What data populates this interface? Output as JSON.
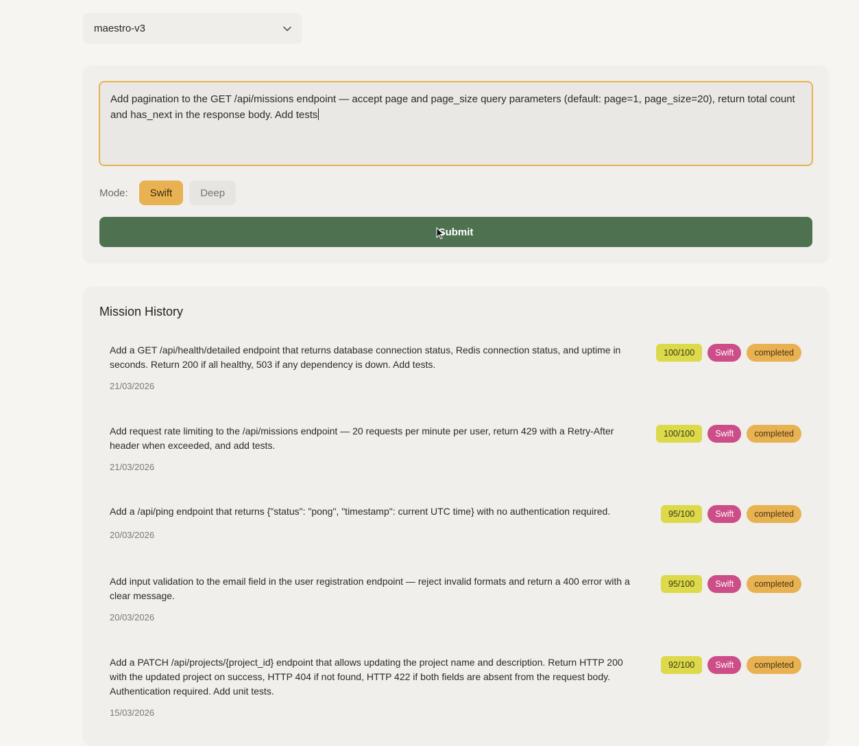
{
  "model_select": {
    "value": "maestro-v3",
    "icon": "chevron-down-icon"
  },
  "composer": {
    "prompt_text": "Add pagination to the GET /api/missions endpoint — accept page and page_size query parameters (default: page=1, page_size=20), return total count and has_next in the response body. Add tests",
    "mode_label": "Mode:",
    "modes": [
      "Swift",
      "Deep"
    ],
    "active_mode": "Swift",
    "submit_label": "Submit"
  },
  "history": {
    "title": "Mission History",
    "missions": [
      {
        "text": "Add a GET /api/health/detailed endpoint that returns database connection status, Redis connection status, and uptime in seconds. Return 200 if all healthy, 503 if any dependency is down. Add tests.",
        "date": "21/03/2026",
        "score": "100/100",
        "mode": "Swift",
        "status": "completed"
      },
      {
        "text": "Add request rate limiting to the /api/missions endpoint — 20 requests per minute per user, return 429 with a Retry-After header when exceeded, and add tests.",
        "date": "21/03/2026",
        "score": "100/100",
        "mode": "Swift",
        "status": "completed"
      },
      {
        "text": "Add a /api/ping endpoint that returns {\"status\": \"pong\", \"timestamp\": current UTC time} with no authentication required.",
        "date": "20/03/2026",
        "score": "95/100",
        "mode": "Swift",
        "status": "completed"
      },
      {
        "text": "Add input validation to the email field in the user registration endpoint — reject invalid formats and return a 400 error with a clear message.",
        "date": "20/03/2026",
        "score": "95/100",
        "mode": "Swift",
        "status": "completed"
      },
      {
        "text": "Add a PATCH /api/projects/{project_id} endpoint that allows updating the project name and description. Return HTTP 200 with the updated project on success, HTTP 404 if not found, HTTP 422 if both fields are absent from the request body. Authentication required. Add unit tests.",
        "date": "15/03/2026",
        "score": "92/100",
        "mode": "Swift",
        "status": "completed"
      }
    ]
  },
  "colors": {
    "accent": "#e8b152",
    "submit": "#4e7150",
    "mode_badge": "#cc4d87",
    "score_badge": "#dcd94a"
  }
}
